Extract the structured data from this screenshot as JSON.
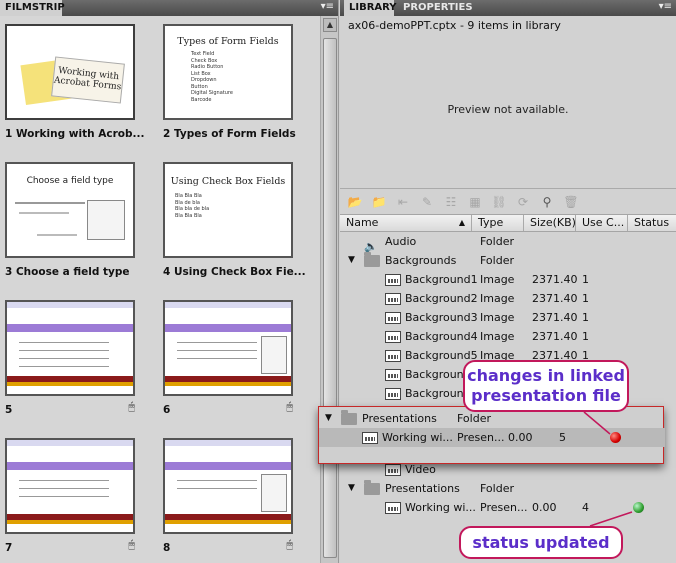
{
  "filmstrip": {
    "tab": "FILMSTRIP",
    "slides": [
      {
        "caption": "1 Working with Acrob...",
        "thumb_title": "Working with Acrobat Forms"
      },
      {
        "caption": "2 Types of Form Fields",
        "thumb_title": "Types of Form Fields",
        "bullets": [
          "Text Field",
          "Check Box",
          "Radio Button",
          "List Box",
          "Dropdown",
          "Button",
          "Digital Signature",
          "Barcode"
        ]
      },
      {
        "caption": "3 Choose a field type",
        "thumb_title": "Choose a field type"
      },
      {
        "caption": "4 Using Check Box Fie...",
        "thumb_title": "Using Check Box Fields",
        "bullets": [
          "Bla Bla Bla",
          "Bla de bla",
          "Bla bla de bla",
          "Bla Bla Bla"
        ]
      },
      {
        "caption": "5"
      },
      {
        "caption": "6"
      },
      {
        "caption": "7"
      },
      {
        "caption": "8"
      }
    ]
  },
  "library": {
    "tabs": [
      "LIBRARY",
      "PROPERTIES"
    ],
    "info": "ax06-demoPPT.cptx - 9 items in library",
    "preview_text": "Preview not available.",
    "columns": [
      "Name",
      "Type",
      "Size(KB)",
      "Use C...",
      "Status"
    ],
    "rows": [
      {
        "name": "Audio",
        "type": "Folder",
        "size": "",
        "use": ""
      },
      {
        "name": "Backgrounds",
        "type": "Folder",
        "size": "",
        "use": ""
      },
      {
        "name": "Background1",
        "type": "Image",
        "size": "2371.40",
        "use": "1"
      },
      {
        "name": "Background2",
        "type": "Image",
        "size": "2371.40",
        "use": "1"
      },
      {
        "name": "Background3",
        "type": "Image",
        "size": "2371.40",
        "use": "1"
      },
      {
        "name": "Background4",
        "type": "Image",
        "size": "2371.40",
        "use": "1"
      },
      {
        "name": "Background5",
        "type": "Image",
        "size": "2371.40",
        "use": "1"
      },
      {
        "name": "Background",
        "type": "",
        "size": "",
        "use": ""
      },
      {
        "name": "Background",
        "type": "",
        "size": "",
        "use": ""
      },
      {
        "name": "Video",
        "type": "",
        "size": "",
        "use": ""
      },
      {
        "name": "Presentations",
        "type": "Folder",
        "size": "",
        "use": ""
      },
      {
        "name": "Working wi...",
        "type": "Presen...",
        "size": "0.00",
        "use": "4"
      }
    ],
    "popup_rows": [
      {
        "name": "Presentations",
        "type": "Folder",
        "size": "",
        "use": ""
      },
      {
        "name": "Working wi...",
        "type": "Presen...",
        "size": "0.00",
        "use": "5"
      }
    ]
  },
  "callouts": {
    "changes": "changes in linked presentation file",
    "updated": "status updated"
  },
  "colors": {
    "callout_border": "#c2185b",
    "callout_text": "#5b2ec9",
    "status_changed": "#d50000",
    "status_ok": "#2e9e2e"
  }
}
